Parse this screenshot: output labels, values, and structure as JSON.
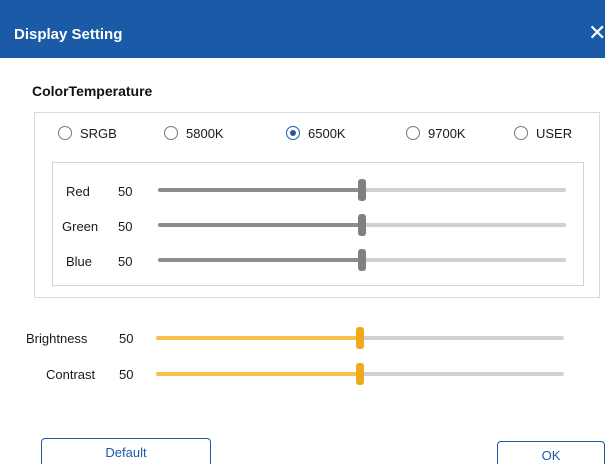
{
  "window": {
    "title": "Display Setting",
    "close_icon": "close-icon",
    "close_glyph": "✕"
  },
  "color_temperature": {
    "label": "ColorTemperature",
    "options": [
      {
        "label": "SRGB",
        "checked": false
      },
      {
        "label": "5800K",
        "checked": false
      },
      {
        "label": "6500K",
        "checked": true
      },
      {
        "label": "9700K",
        "checked": false
      },
      {
        "label": "USER",
        "checked": false
      }
    ],
    "selected": "6500K",
    "channels": [
      {
        "label": "Red",
        "value": "50",
        "level": 0.5
      },
      {
        "label": "Green",
        "value": "50",
        "level": 0.5
      },
      {
        "label": "Blue",
        "value": "50",
        "level": 0.5
      }
    ]
  },
  "adjustments": [
    {
      "label": "Brightness",
      "value": "50",
      "level": 0.5
    },
    {
      "label": "Contrast",
      "value": "50",
      "level": 0.5
    }
  ],
  "buttons": {
    "default_label": "Default",
    "ok_label": "OK"
  },
  "colors": {
    "title_bar": "#1a5aa6",
    "accent": "#1a5aa6",
    "rgb_slider": "#808080",
    "adjust_slider": "#f0a81c",
    "adjust_fill": "#f5c24a"
  }
}
